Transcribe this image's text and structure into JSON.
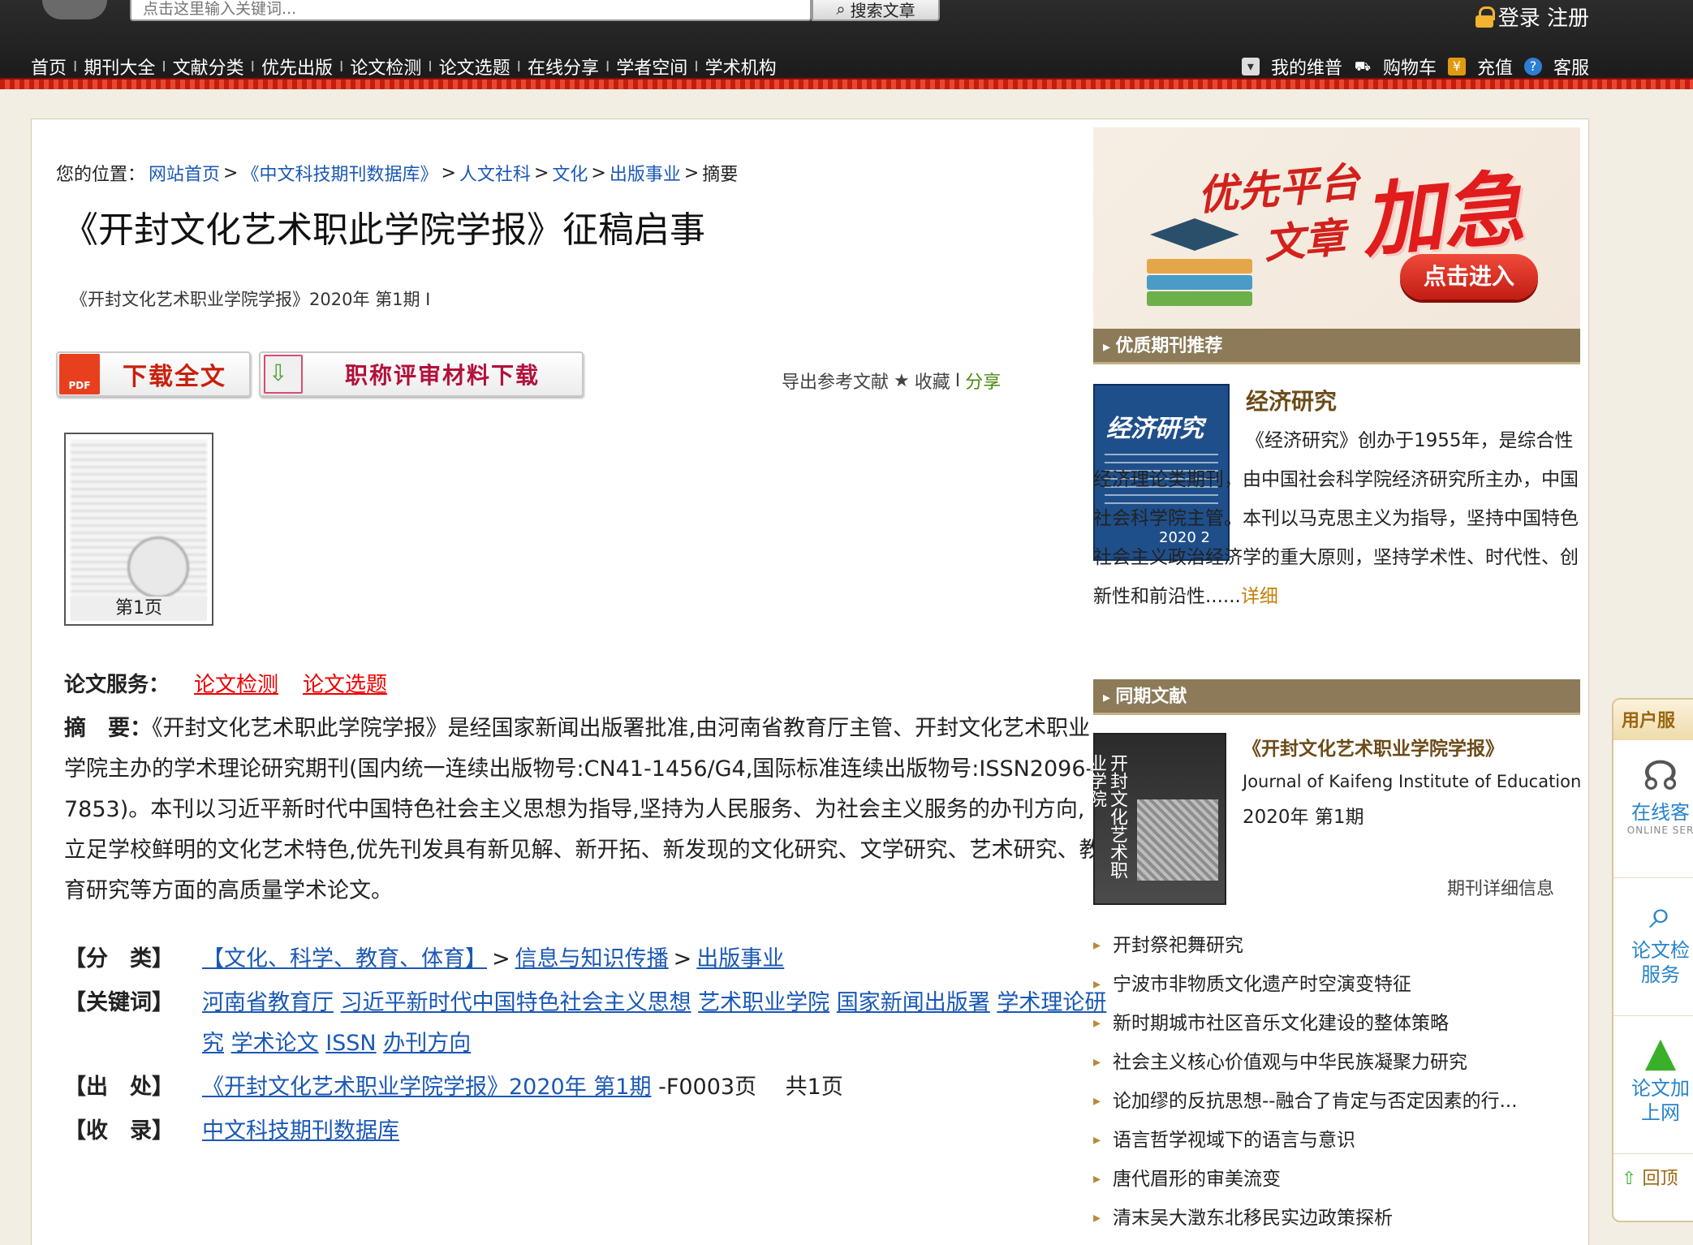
{
  "header": {
    "search_placeholder": "点击这里输入关键词...",
    "search_button": "搜索文章",
    "login_text": "登录 注册",
    "nav": [
      "首页",
      "期刊大全",
      "文献分类",
      "优先出版",
      "论文检测",
      "论文选题",
      "在线分享",
      "学者空间",
      "学术机构"
    ],
    "user_nav": [
      "我的维普",
      "购物车",
      "充值",
      "客服"
    ]
  },
  "breadcrumb": {
    "prefix": "您的位置：",
    "items": [
      "网站首页",
      "《中文科技期刊数据库》",
      "人文社科",
      "文化",
      "出版事业"
    ],
    "current": "摘要"
  },
  "article": {
    "title": "《开封文化艺术职此学院学报》征稿启事",
    "source_line": "《开封文化艺术职业学院学报》2020年 第1期 I",
    "download_label": "下载全文",
    "pdf_text": "PDF",
    "material_label": "职称评审材料下载",
    "export": "导出参考文献",
    "star": "★",
    "collect": "收藏",
    "separator": "I",
    "share": "分享",
    "thumb_caption": "第1页",
    "services_label": "论文服务：",
    "services": [
      "论文检测",
      "论文选题"
    ],
    "abstract_label": "摘　要：",
    "abstract": "《开封文化艺术职此学院学报》是经国家新闻出版署批准,由河南省教育厅主管、开封文化艺术职业学院主办的学术理论研究期刊(国内统一连续出版物号:CN41-1456/G4,国际标准连续出版物号:ISSN2096-7853)。本刊以习近平新时代中国特色社会主义思想为指导,坚持为人民服务、为社会主义服务的办刊方向,立足学校鲜明的文化艺术特色,优先刊发具有新见解、新开拓、新发现的文化研究、文学研究、艺术研究、教育研究等方面的高质量学术论文。",
    "meta": {
      "category_label": "【分　类】",
      "category": [
        "【文化、科学、教育、体育】",
        "信息与知识传播",
        "出版事业"
      ],
      "keywords_label": "【关键词】",
      "keywords": [
        "河南省教育厅",
        "习近平新时代中国特色社会主义思想",
        "艺术职业学院",
        "国家新闻出版署",
        "学术理论研究",
        "学术论文",
        "ISSN",
        "办刊方向"
      ],
      "source_label": "【出　处】",
      "source_link": "《开封文化艺术职业学院学报》2020年 第1期",
      "source_pages": "-F0003页　 共1页",
      "indexed_label": "【收　录】",
      "indexed": "中文科技期刊数据库"
    }
  },
  "sidebar": {
    "banner": {
      "line1": "优先平台",
      "line2": "文章",
      "line3": "加急",
      "button": "点击进入"
    },
    "recommend_head": "优质期刊推荐",
    "recommend": {
      "cover_text": "经济研究",
      "cover_year": "2020 2",
      "title": "经济研究",
      "text": "《经济研究》创办于1955年，是综合性经济理论类期刊，由中国社会科学院经济研究所主办，中国社会科学院主管。本刊以马克思主义为指导，坚持中国特色社会主义政治经济学的重大原则，坚持学术性、时代性、创新性和前沿性......",
      "more": "详细"
    },
    "same_head": "同期文献",
    "same": {
      "cover_text": "开封文化艺术职业学院",
      "title": "《开封文化艺术职业学院学报》",
      "en_title": "Journal of Kaifeng Institute of Education",
      "issue": "2020年 第1期",
      "detail": "期刊详细信息",
      "list": [
        "开封祭祀舞研究",
        "宁波市非物质文化遗产时空演变特征",
        "新时期城市社区音乐文化建设的整体策略",
        "社会主义核心价值观与中华民族凝聚力研究",
        "论加缪的反抗思想--融合了肯定与否定因素的行...",
        "语言哲学视域下的语言与意识",
        "唐代眉形的审美流变",
        "清末吴大澂东北移民实边政策探析"
      ]
    }
  },
  "float": {
    "title": "用户服",
    "items": [
      {
        "label": "在线客",
        "sub": "ONLINE SER"
      },
      {
        "label": "论文检",
        "sub": "服务"
      },
      {
        "label": "论文加",
        "sub": "上网"
      }
    ],
    "back": "回顶"
  },
  "colors": {
    "link": "#1a58b5",
    "red": "#e00000",
    "section_head": "#8c7a58"
  }
}
